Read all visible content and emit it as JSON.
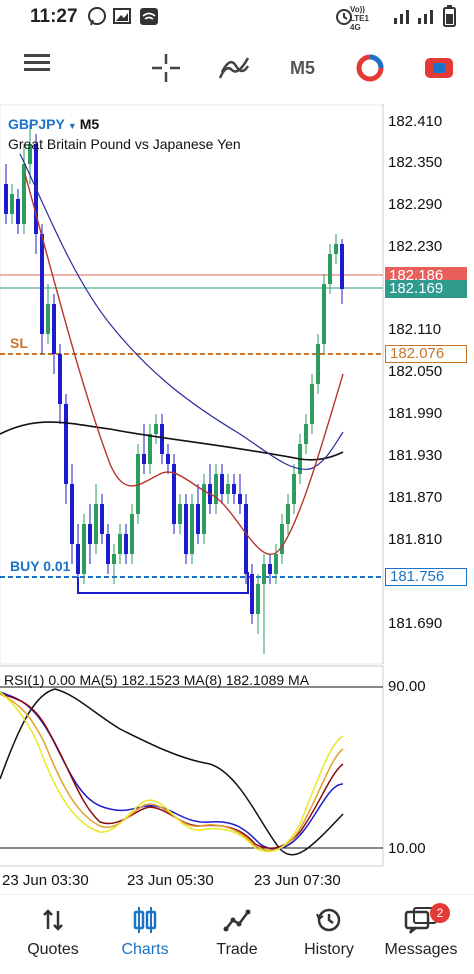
{
  "status_bar": {
    "time": "11:27",
    "network": "Vo)) LTE1 4G",
    "icons": [
      "whatsapp-icon",
      "image-icon",
      "wifi-router-icon",
      "alarm-icon",
      "signal-icon",
      "battery-icon"
    ]
  },
  "toolbar": {
    "timeframe": "M5",
    "icons": [
      "menu-icon",
      "crosshair-icon",
      "indicators-icon",
      "objects-icon",
      "trade-icon"
    ]
  },
  "chart": {
    "symbol": "GBPJPY",
    "symbol_arrow": "▼",
    "timeframe": "M5",
    "description": "Great Britain Pound vs Japanese Yen",
    "price_labels": [
      "182.410",
      "182.350",
      "182.290",
      "182.230",
      "182.110",
      "182.050",
      "181.990",
      "181.930",
      "181.870",
      "181.810",
      "181.690"
    ],
    "bid_price": "182.186",
    "ask_price": "182.169",
    "sl_label": "SL",
    "sl_price": "182.076",
    "buy_label": "BUY 0.01",
    "buy_price": "181.756",
    "colors": {
      "bull": "#2e9b5f",
      "bear": "#1c1ccc",
      "ma_red": "#b8342a",
      "ma_blue": "#2a2a9a",
      "ma_black": "#111111",
      "bid": "#e9605a",
      "ask": "#2e9b8c",
      "sl": "#c8752c",
      "buy": "#1a73c8"
    }
  },
  "rsi": {
    "header": "RSI(1) 0.00 MA(5) 182.1523 MA(8) 182.1089 MA",
    "level_high": "90.00",
    "level_low": "10.00"
  },
  "time_axis": [
    "23 Jun 03:30",
    "23 Jun 05:30",
    "23 Jun 07:30"
  ],
  "bottom_nav": {
    "items": [
      {
        "label": "Quotes",
        "icon": "quotes-icon"
      },
      {
        "label": "Charts",
        "icon": "charts-icon"
      },
      {
        "label": "Trade",
        "icon": "trade-icon"
      },
      {
        "label": "History",
        "icon": "history-icon"
      },
      {
        "label": "Messages",
        "icon": "messages-icon"
      }
    ],
    "active": "Charts",
    "messages_badge": "2"
  }
}
